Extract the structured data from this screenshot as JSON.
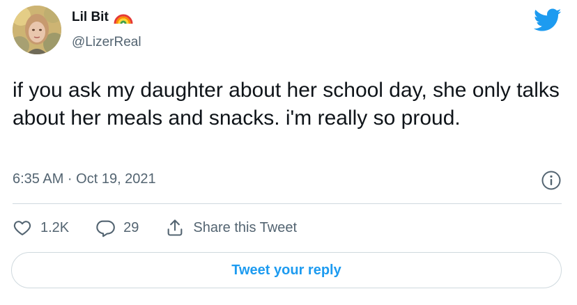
{
  "author": {
    "display_name": "Lil Bit",
    "handle": "@LizerReal",
    "emoji": "rainbow-icon"
  },
  "tweet": {
    "text": "if you ask my daughter about her school day, she only talks about her meals and snacks. i'm really so proud.",
    "timestamp": "6:35 AM · Oct 19, 2021"
  },
  "actions": {
    "likes": "1.2K",
    "replies": "29",
    "share_label": "Share this Tweet"
  },
  "reply_button": "Tweet your reply",
  "colors": {
    "brand": "#1d9bf0",
    "secondary_text": "#536471",
    "divider": "#cfd9de"
  }
}
